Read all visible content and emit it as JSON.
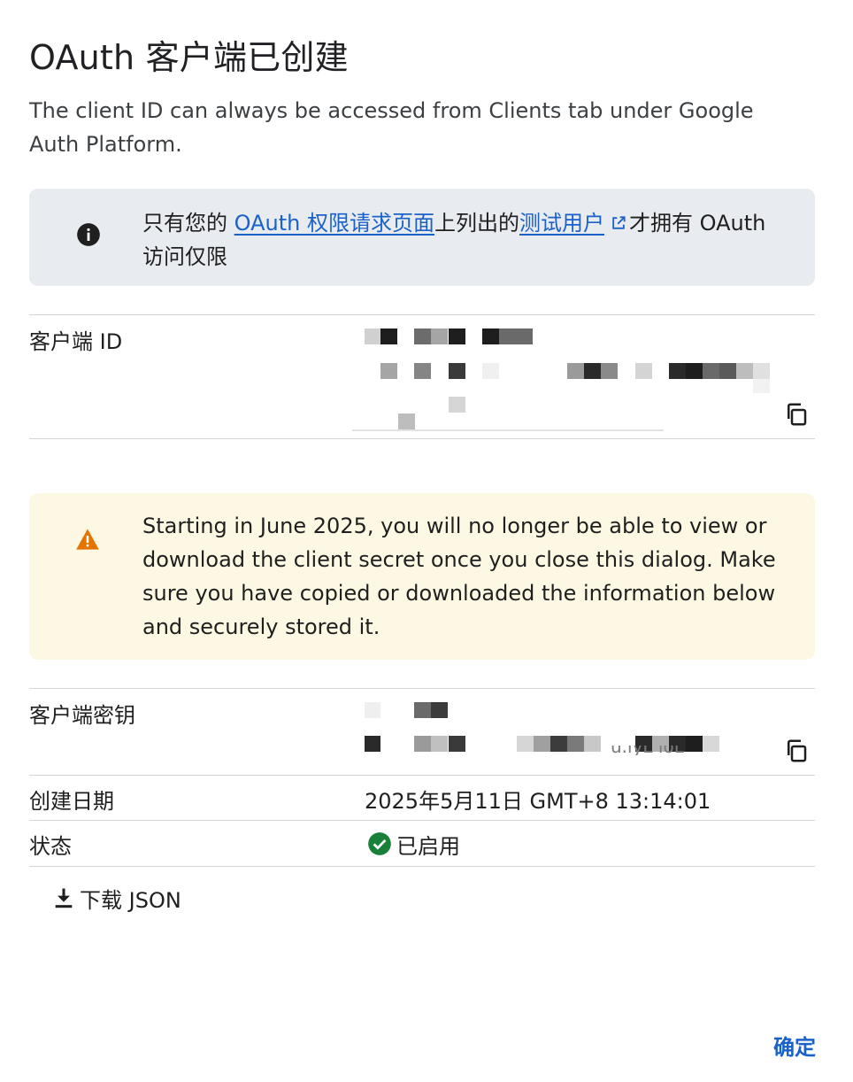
{
  "dialog": {
    "title": "OAuth 客户端已创建",
    "subtitle": "The client ID can always be accessed from Clients tab under Google Auth Platform."
  },
  "info_notice": {
    "prefix": "只有您的 ",
    "link1": "OAuth 权限请求页面",
    "middle": "上列出的",
    "link2": "测试用户",
    "suffix": "才拥有 OAuth 访问仅限"
  },
  "client_id": {
    "label": "客户端 ID"
  },
  "warning": {
    "text": "Starting in June 2025, you will no longer be able to view or download the client secret once you close this dialog. Make sure you have copied or downloaded the information below and securely stored it."
  },
  "client_secret": {
    "label": "客户端密钥",
    "partial_visible": "_u.iyL ioL"
  },
  "created": {
    "label": "创建日期",
    "value": "2025年5月11日 GMT+8 13:14:01"
  },
  "status": {
    "label": "状态",
    "value": "已启用"
  },
  "actions": {
    "download_label": "下载 JSON",
    "ok_label": "确定"
  },
  "colors": {
    "link": "#1a62c9",
    "info_bg": "#e8ebef",
    "warning_bg": "#fdf8e3",
    "warning_icon": "#e37400",
    "status_ok": "#188038"
  }
}
